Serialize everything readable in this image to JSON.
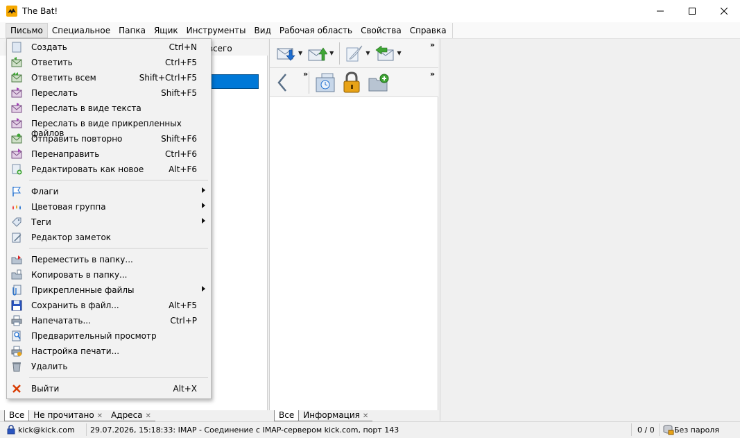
{
  "window": {
    "title": "The Bat!",
    "minimize": "—",
    "maximize": "☐",
    "close": "✕"
  },
  "menubar": {
    "items": [
      "Письмо",
      "Специальное",
      "Папка",
      "Ящик",
      "Инструменты",
      "Вид",
      "Рабочая область",
      "Свойства",
      "Справка"
    ],
    "active_index": 0
  },
  "left_pane": {
    "header_partial": "всего"
  },
  "toolbar": {
    "row1_overflow": "»",
    "row2_overflow": "»"
  },
  "dropdown": {
    "items": [
      {
        "label": "Создать",
        "shortcut": "Ctrl+N",
        "icon": "new-message-icon"
      },
      {
        "label": "Ответить",
        "shortcut": "Ctrl+F5",
        "icon": "reply-icon"
      },
      {
        "label": "Ответить всем",
        "shortcut": "Shift+Ctrl+F5",
        "icon": "reply-all-icon"
      },
      {
        "label": "Переслать",
        "shortcut": "Shift+F5",
        "icon": "forward-icon"
      },
      {
        "label": "Переслать в виде текста",
        "shortcut": "",
        "icon": "forward-text-icon"
      },
      {
        "label": "Переслать в виде прикрепленных файлов",
        "shortcut": "",
        "icon": "forward-attach-icon"
      },
      {
        "label": "Отправить повторно",
        "shortcut": "Shift+F6",
        "icon": "resend-icon"
      },
      {
        "label": "Перенаправить",
        "shortcut": "Ctrl+F6",
        "icon": "redirect-icon"
      },
      {
        "label": "Редактировать как новое",
        "shortcut": "Alt+F6",
        "icon": "edit-as-new-icon"
      },
      {
        "label": "Флаги",
        "shortcut": "",
        "icon": "flag-icon",
        "submenu": true
      },
      {
        "label": "Цветовая группа",
        "shortcut": "",
        "icon": "color-group-icon",
        "submenu": true
      },
      {
        "label": "Теги",
        "shortcut": "",
        "icon": "tag-icon",
        "submenu": true
      },
      {
        "label": "Редактор заметок",
        "shortcut": "",
        "icon": "notes-icon"
      },
      {
        "label": "Переместить в папку...",
        "shortcut": "",
        "icon": "move-folder-icon"
      },
      {
        "label": "Копировать в папку...",
        "shortcut": "",
        "icon": "copy-folder-icon"
      },
      {
        "label": "Прикрепленные файлы",
        "shortcut": "",
        "icon": "attachment-icon",
        "submenu": true
      },
      {
        "label": "Сохранить в файл...",
        "shortcut": "Alt+F5",
        "icon": "save-icon"
      },
      {
        "label": "Напечатать...",
        "shortcut": "Ctrl+P",
        "icon": "print-icon"
      },
      {
        "label": "Предварительный просмотр",
        "shortcut": "",
        "icon": "preview-icon"
      },
      {
        "label": "Настройка печати...",
        "shortcut": "",
        "icon": "print-setup-icon"
      },
      {
        "label": "Удалить",
        "shortcut": "",
        "icon": "trash-icon"
      },
      {
        "label": "Выйти",
        "shortcut": "Alt+X",
        "icon": "exit-icon"
      }
    ]
  },
  "tabs_left": [
    {
      "label": "Все"
    },
    {
      "label": "Не прочитано",
      "close": "✕"
    },
    {
      "label": "Адреса",
      "close": "✕"
    }
  ],
  "tabs_mid": [
    {
      "label": "Все"
    },
    {
      "label": "Информация",
      "close": "✕"
    }
  ],
  "statusbar": {
    "account": "kick@kick.com",
    "message": "29.07.2026, 15:18:33: IMAP  - Соединение с IMAP-сервером kick.com, порт 143",
    "count": "0 / 0",
    "password": "Без пароля"
  },
  "colors": {
    "selection": "#0078d7",
    "accent_green": "#3fa535",
    "accent_blue": "#1f6fd1",
    "exit_red": "#d83b01"
  }
}
